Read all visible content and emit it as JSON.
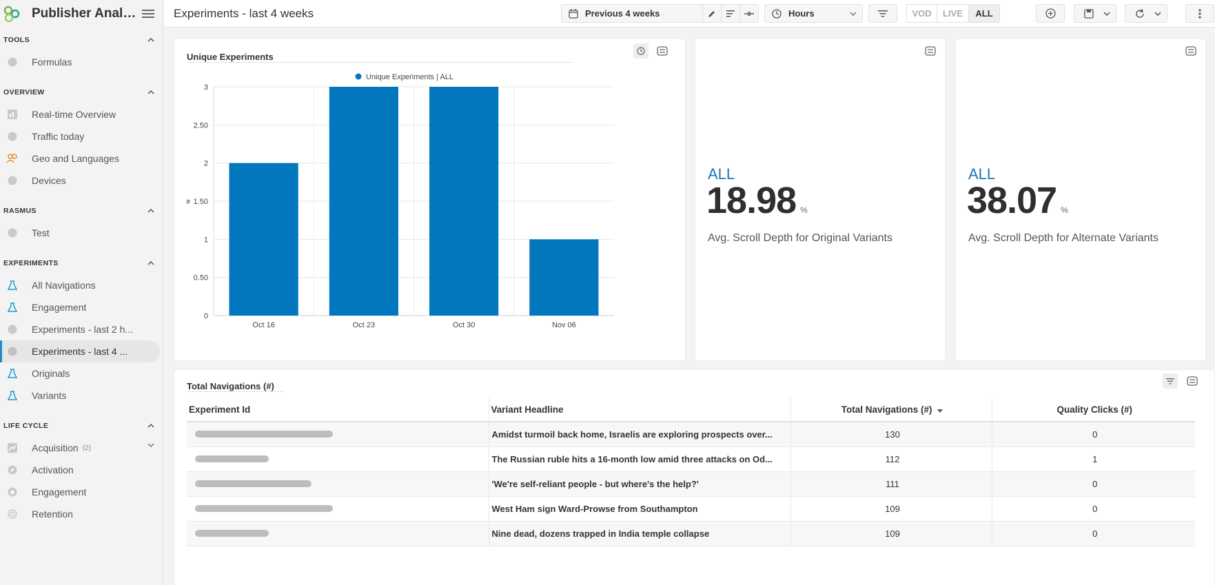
{
  "app": {
    "name": "Publisher Analytics",
    "title": "Publisher Analyt..."
  },
  "page": {
    "title": "Experiments - last 4 weeks"
  },
  "toolbar": {
    "period": "Previous 4 weeks",
    "granularity": "Hours",
    "seg_vod": "VOD",
    "seg_live": "LIVE",
    "seg_all": "ALL"
  },
  "sidebar": {
    "sections": [
      {
        "label": "TOOLS",
        "items": [
          {
            "label": "Formulas"
          }
        ]
      },
      {
        "label": "OVERVIEW",
        "items": [
          {
            "label": "Real-time Overview"
          },
          {
            "label": "Traffic today"
          },
          {
            "label": "Geo and Languages"
          },
          {
            "label": "Devices"
          }
        ]
      },
      {
        "label": "RASMUS",
        "items": [
          {
            "label": "Test"
          }
        ]
      },
      {
        "label": "EXPERIMENTS",
        "items": [
          {
            "label": "All Navigations"
          },
          {
            "label": "Engagement"
          },
          {
            "label": "Experiments - last 2 h..."
          },
          {
            "label": "Experiments - last 4 ..."
          },
          {
            "label": "Originals"
          },
          {
            "label": "Variants"
          }
        ]
      },
      {
        "label": "LIFE CYCLE",
        "items": [
          {
            "label": "Acquisition",
            "count": "(2)"
          },
          {
            "label": "Activation"
          },
          {
            "label": "Engagement"
          },
          {
            "label": "Retention"
          }
        ]
      }
    ]
  },
  "chart_card": {
    "title": "Unique Experiments"
  },
  "chart_data": {
    "type": "bar",
    "title": "Unique Experiments",
    "categories": [
      "Oct 16",
      "Oct 23",
      "Oct 30",
      "Nov 06"
    ],
    "series": [
      {
        "name": "Unique Experiments | ALL",
        "values": [
          2,
          3,
          3,
          1
        ]
      }
    ],
    "ylabel": "#",
    "ylim": [
      0,
      3
    ],
    "yticks": [
      "0",
      "0.50",
      "1",
      "1.50",
      "2",
      "2.50",
      "3"
    ],
    "color": "#0277bd",
    "grid": true,
    "legend": "top-center"
  },
  "kpi1": {
    "scope": "ALL",
    "value": "18.98",
    "unit": "%",
    "label": "Avg. Scroll Depth for Original Variants"
  },
  "kpi2": {
    "scope": "ALL",
    "value": "38.07",
    "unit": "%",
    "label": "Avg. Scroll Depth for Alternate Variants"
  },
  "table": {
    "title": "Total Navigations (#)",
    "headers": {
      "id": "Experiment Id",
      "headline": "Variant Headline",
      "nav": "Total Navigations (#)",
      "clicks": "Quality Clicks (#)"
    },
    "rows": [
      {
        "headline": "Amidst turmoil back home, Israelis are exploring prospects over...",
        "nav": "130",
        "clicks": "0"
      },
      {
        "headline": "The Russian ruble hits a 16-month low amid three attacks on Od...",
        "nav": "112",
        "clicks": "1"
      },
      {
        "headline": "'We're self-reliant people - but where's the help?'",
        "nav": "111",
        "clicks": "0"
      },
      {
        "headline": "West Ham sign Ward-Prowse from Southampton",
        "nav": "109",
        "clicks": "0"
      },
      {
        "headline": "Nine dead, dozens trapped in India temple collapse",
        "nav": "109",
        "clicks": "0"
      }
    ]
  }
}
